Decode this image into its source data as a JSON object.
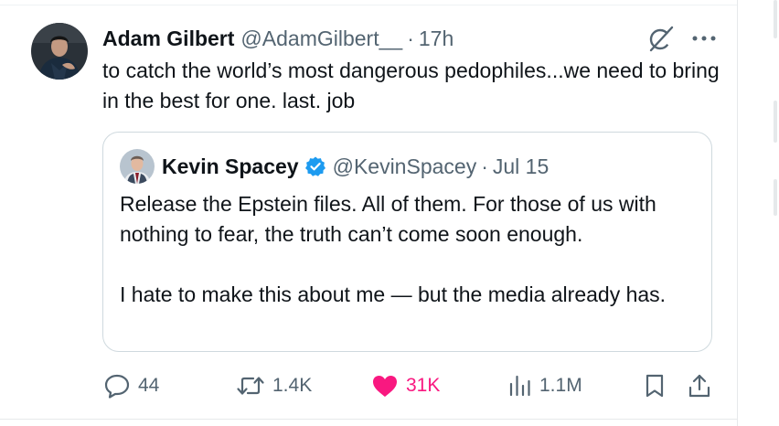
{
  "post": {
    "author_name": "Adam Gilbert",
    "author_handle": "@AdamGilbert__",
    "separator": "·",
    "time": "17h",
    "text": "to catch the world’s most dangerous pedophiles...we need to bring in the best for one. last. job",
    "icons": {
      "grok": "grok-icon",
      "more": "more-icon",
      "avatar": "user-avatar"
    }
  },
  "quote": {
    "author_name": "Kevin Spacey",
    "verified": true,
    "verified_color": "#1d9bf0",
    "author_handle": "@KevinSpacey",
    "separator": "·",
    "date": "Jul 15",
    "paragraph_1": "Release the Epstein files. All of them. For those of us with nothing to fear, the truth can’t come soon enough.",
    "paragraph_2": "I hate to make this about me — but the media already has."
  },
  "actions": {
    "replies": "44",
    "reposts": "1.4K",
    "likes": "31K",
    "liked": true,
    "like_color": "#f91880",
    "views": "1.1M",
    "icons": [
      "reply-icon",
      "repost-icon",
      "like-icon",
      "views-icon",
      "bookmark-icon",
      "share-icon"
    ]
  },
  "colors": {
    "text_primary": "#0f1419",
    "text_secondary": "#536471",
    "border": "#cfd9de"
  }
}
